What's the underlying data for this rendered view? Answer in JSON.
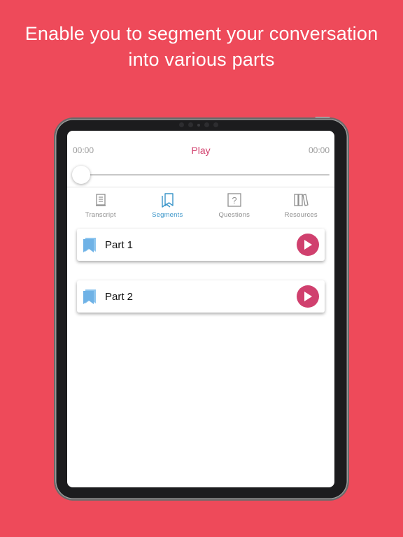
{
  "headline": {
    "line1": "Enable you to segment your conversation",
    "line2": "into various parts"
  },
  "player": {
    "time_start": "00:00",
    "time_end": "00:00",
    "play_label": "Play",
    "progress": 0
  },
  "tabs": [
    {
      "label": "Transcript",
      "icon": "transcript-icon",
      "active": false
    },
    {
      "label": "Segments",
      "icon": "bookmarks-icon",
      "active": true
    },
    {
      "label": "Questions",
      "icon": "question-icon",
      "active": false
    },
    {
      "label": "Resources",
      "icon": "books-icon",
      "active": false
    }
  ],
  "segments": [
    {
      "label": "Part 1",
      "icon": "bookmark-icon",
      "action_icon": "play-icon"
    },
    {
      "label": "Part 2",
      "icon": "bookmark-icon",
      "action_icon": "play-icon"
    }
  ],
  "colors": {
    "background": "#ee4a5a",
    "accent_pink": "#d0406e",
    "accent_blue": "#3a95c9",
    "bookmark_blue": "#6fb2e6"
  }
}
